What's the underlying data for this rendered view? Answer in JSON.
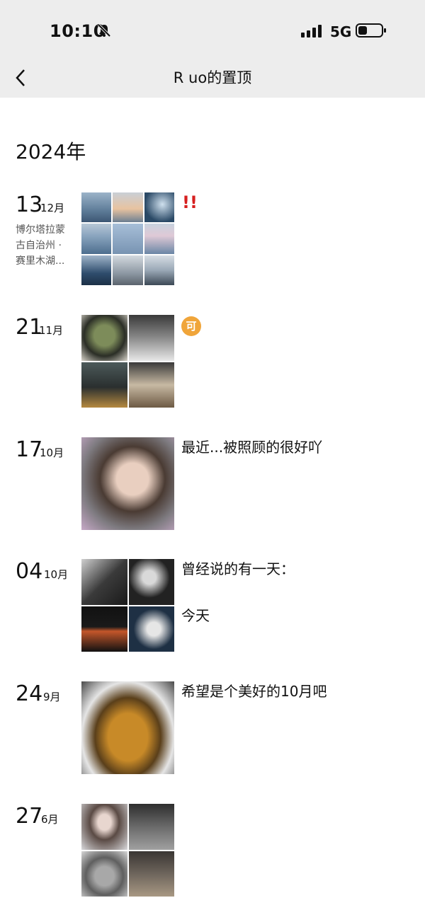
{
  "status_bar": {
    "time": "10:10",
    "network": "5G"
  },
  "header": {
    "title": "R uo的置顶"
  },
  "year_label": "2024年",
  "posts": [
    {
      "day": "13",
      "month": "12月",
      "location": [
        "博尔塔拉蒙",
        "古自治州 ·",
        "赛里木湖..."
      ],
      "mark": "!!",
      "photo_count": 9
    },
    {
      "day": "21",
      "month": "11月",
      "badge": "可",
      "photo_count": 4
    },
    {
      "day": "17",
      "month": "10月",
      "caption": "最近...被照顾的很好吖",
      "photo_count": 1
    },
    {
      "day": "04",
      "month": "10月",
      "caption_line1": "曾经说的有一天：",
      "caption_line2": "今天",
      "photo_count": 4
    },
    {
      "day": "24",
      "month": "9月",
      "caption": "希望是个美好的10月吧",
      "photo_count": 1
    },
    {
      "day": "27",
      "month": "6月",
      "photo_count": 4
    }
  ],
  "colors": {
    "status_bg": "#ededed",
    "mark_red": "#d61f1f",
    "badge_orange": "#f0a53a"
  },
  "icons": [
    "bell-muted-icon",
    "signal-bars-icon",
    "battery-icon",
    "back-chevron-icon"
  ]
}
